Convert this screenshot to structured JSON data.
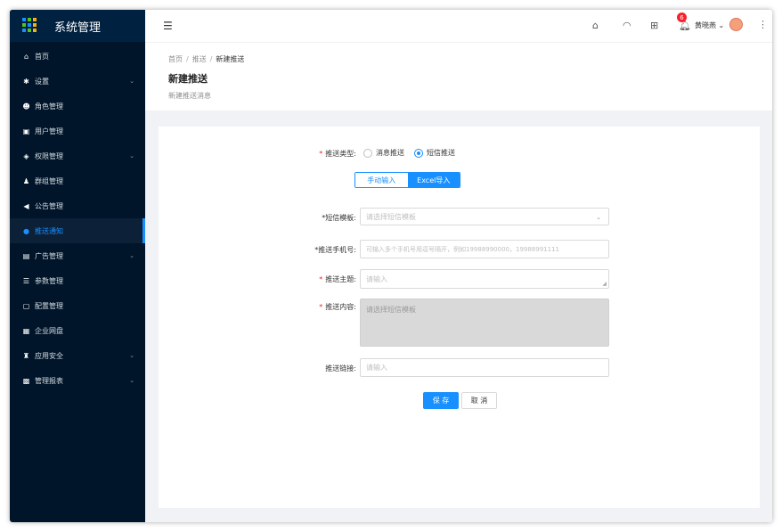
{
  "app": {
    "title": "系统管理"
  },
  "sidebar": {
    "items": [
      {
        "label": "首页",
        "icon": "home-icon",
        "glyph": "⌂",
        "has_children": false
      },
      {
        "label": "设置",
        "icon": "gear-icon",
        "glyph": "✱",
        "has_children": true
      },
      {
        "label": "角色管理",
        "icon": "role-icon",
        "glyph": "☻",
        "has_children": false
      },
      {
        "label": "用户管理",
        "icon": "user-card-icon",
        "glyph": "▣",
        "has_children": false
      },
      {
        "label": "权限管理",
        "icon": "shield-icon",
        "glyph": "◈",
        "has_children": true
      },
      {
        "label": "群组管理",
        "icon": "group-icon",
        "glyph": "♟",
        "has_children": false
      },
      {
        "label": "公告管理",
        "icon": "megaphone-icon",
        "glyph": "◀",
        "has_children": false
      },
      {
        "label": "推送通知",
        "icon": "bell-icon",
        "glyph": "●",
        "has_children": false,
        "active": true
      },
      {
        "label": "广告管理",
        "icon": "ad-icon",
        "glyph": "▤",
        "has_children": true
      },
      {
        "label": "参数管理",
        "icon": "params-icon",
        "glyph": "☰",
        "has_children": false
      },
      {
        "label": "配置管理",
        "icon": "config-icon",
        "glyph": "▢",
        "has_children": false
      },
      {
        "label": "企业网盘",
        "icon": "drive-icon",
        "glyph": "▦",
        "has_children": false
      },
      {
        "label": "应用安全",
        "icon": "security-icon",
        "glyph": "♜",
        "has_children": true
      },
      {
        "label": "管理报表",
        "icon": "report-icon",
        "glyph": "▩",
        "has_children": true
      }
    ]
  },
  "header": {
    "menu_icon": "☰",
    "notification_count": "6",
    "username": "黄晓燕",
    "user_chevron": "⌄",
    "more_icon": "⋮"
  },
  "breadcrumb": {
    "items": [
      "首页",
      "推送"
    ],
    "current": "新建推送"
  },
  "page": {
    "title": "新建推送",
    "subtitle": "新建推送消息"
  },
  "form": {
    "push_type": {
      "label": "推送类型:",
      "options": [
        "消息推送",
        "短信推送"
      ],
      "selected": "短信推送"
    },
    "input_mode": {
      "options": [
        "手动输入",
        "Excel导入"
      ],
      "selected": "Excel导入"
    },
    "sms_template": {
      "label": "*短信模板:",
      "placeholder": "请选择短信模板"
    },
    "phone": {
      "label": "*推送手机号:",
      "placeholder": "可输入多个手机号用逗号隔开，例如19988990000，19988991111"
    },
    "subject": {
      "label": "推送主题:",
      "placeholder": "请输入"
    },
    "content": {
      "label": "推送内容:",
      "placeholder": "请选择短信模板"
    },
    "link": {
      "label": "推送链接:",
      "placeholder": "请输入"
    }
  },
  "actions": {
    "save": "保 存",
    "cancel": "取 消"
  },
  "colors": {
    "primary": "#1890ff",
    "sidebar_bg": "#001529",
    "required": "#f5222d"
  }
}
